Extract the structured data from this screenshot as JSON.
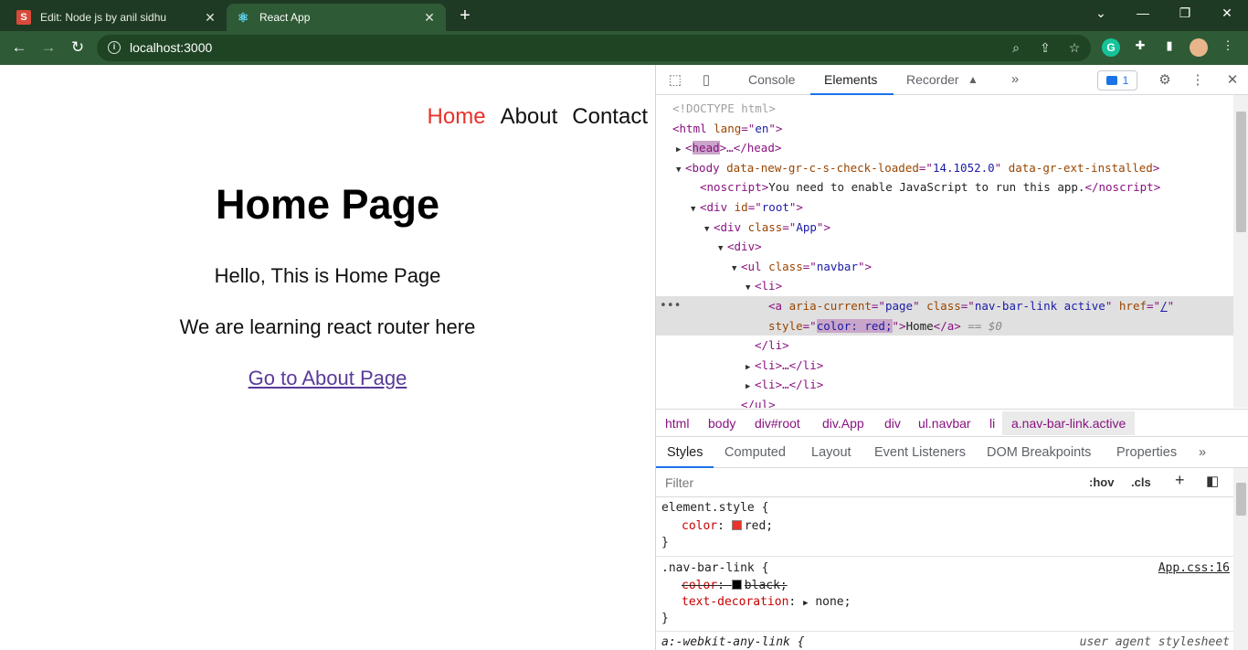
{
  "browser": {
    "tabs": [
      {
        "title": "Edit: Node js by anil sidhu",
        "favicon": "S"
      },
      {
        "title": "React App",
        "favicon": "react-icon"
      }
    ],
    "close_glyph": "✕",
    "new_tab_glyph": "+",
    "url": "localhost:3000"
  },
  "page": {
    "nav": {
      "home": "Home",
      "about": "About",
      "contact": "Contact"
    },
    "active_color": "#e8322a",
    "heading": "Home Page",
    "line1": "Hello, This is Home Page",
    "line2": "We are learning react router here",
    "link": "Go to About Page"
  },
  "devtools": {
    "tabs": {
      "console": "Console",
      "elements": "Elements",
      "recorder": "Recorder"
    },
    "issues_count": "1",
    "dom": {
      "doctype": "<!DOCTYPE html>",
      "html_lang": "en",
      "head_tag": "head",
      "head_rest": ">…</head>",
      "body_attr1_name": "data-new-gr-c-s-check-loaded",
      "body_attr1_value": "14.1052.0",
      "body_attr2_name": "data-gr-ext-installed",
      "noscript_text": "You need to enable JavaScript to run this app.",
      "div_id": "root",
      "div_class": "App",
      "ul_class": "navbar",
      "a_aria_current": "page",
      "a_class": "nav-bar-link active",
      "a_href": "/",
      "a_style_value": "color: red;",
      "a_text": "Home",
      "dollar0": "== $0",
      "li_collapsed": "<li>…</li>"
    },
    "breadcrumb": [
      "html",
      "body",
      "div#root",
      "div.App",
      "div",
      "ul.navbar",
      "li",
      "a.nav-bar-link.active"
    ],
    "styles_tabs": [
      "Styles",
      "Computed",
      "Layout",
      "Event Listeners",
      "DOM Breakpoints",
      "Properties"
    ],
    "filter_placeholder": "Filter",
    "hov": ":hov",
    "cls": ".cls",
    "rules": {
      "element_style_selector": "element.style {",
      "element_style_prop": "color",
      "element_style_value": "red;",
      "element_style_swatch": "#e8322a",
      "nav_bar_link_selector": ".nav-bar-link {",
      "nav_bar_link_source": "App.css:16",
      "nav_prop1": "color",
      "nav_value1": "black;",
      "nav_swatch1": "#000000",
      "nav_prop2": "text-decoration",
      "nav_value2": "none;",
      "webkit_selector": "a:-webkit-any-link {",
      "webkit_source": "user agent stylesheet",
      "close_brace": "}"
    }
  }
}
